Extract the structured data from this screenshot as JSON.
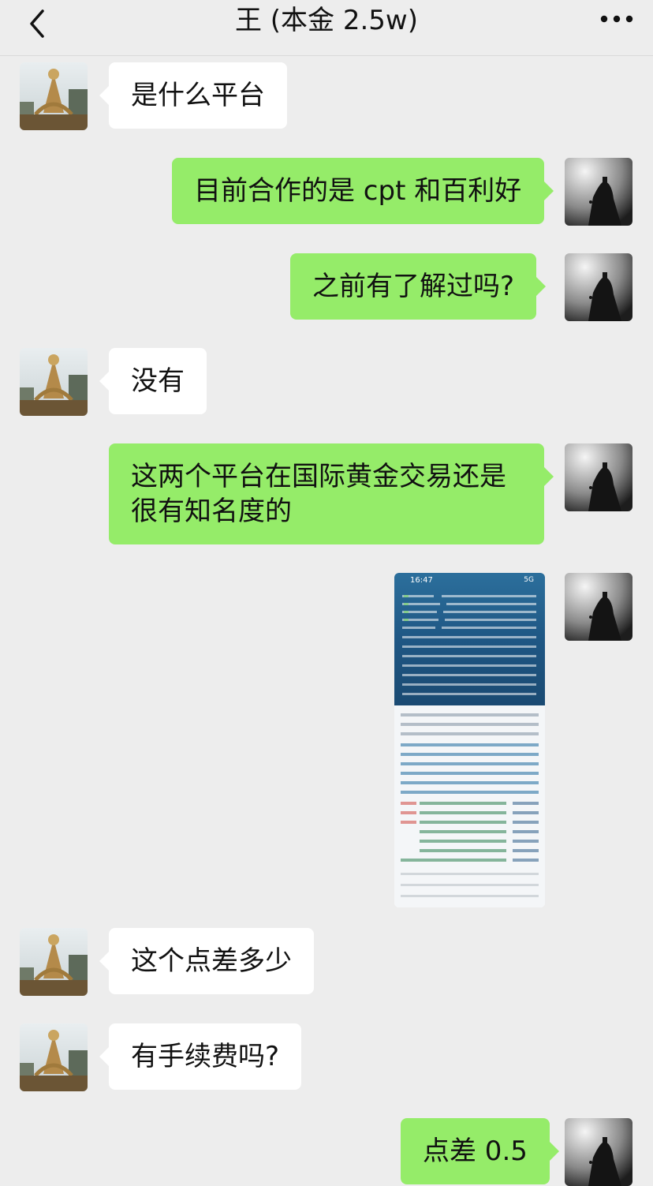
{
  "header": {
    "title": "王 (本金 2.5w)",
    "back_icon": "chevron-left-icon",
    "more_icon": "ellipsis-icon"
  },
  "messages": [
    {
      "side": "in",
      "text": "是什么平台"
    },
    {
      "side": "out",
      "text": "目前合作的是 cpt 和百利好"
    },
    {
      "side": "out",
      "text": "之前有了解过吗?"
    },
    {
      "side": "in",
      "text": "没有"
    },
    {
      "side": "out",
      "text": "这两个平台在国际黄金交易还是很有知名度的"
    },
    {
      "side": "out",
      "type": "image",
      "image_time": "16:47",
      "image_status": "5G"
    },
    {
      "side": "in",
      "text": "这个点差多少"
    },
    {
      "side": "in",
      "text": "有手续费吗?"
    },
    {
      "side": "out",
      "text": "点差 0.5"
    }
  ],
  "colors": {
    "background": "#ededed",
    "outgoing_bubble": "#95ec69",
    "incoming_bubble": "#ffffff"
  }
}
